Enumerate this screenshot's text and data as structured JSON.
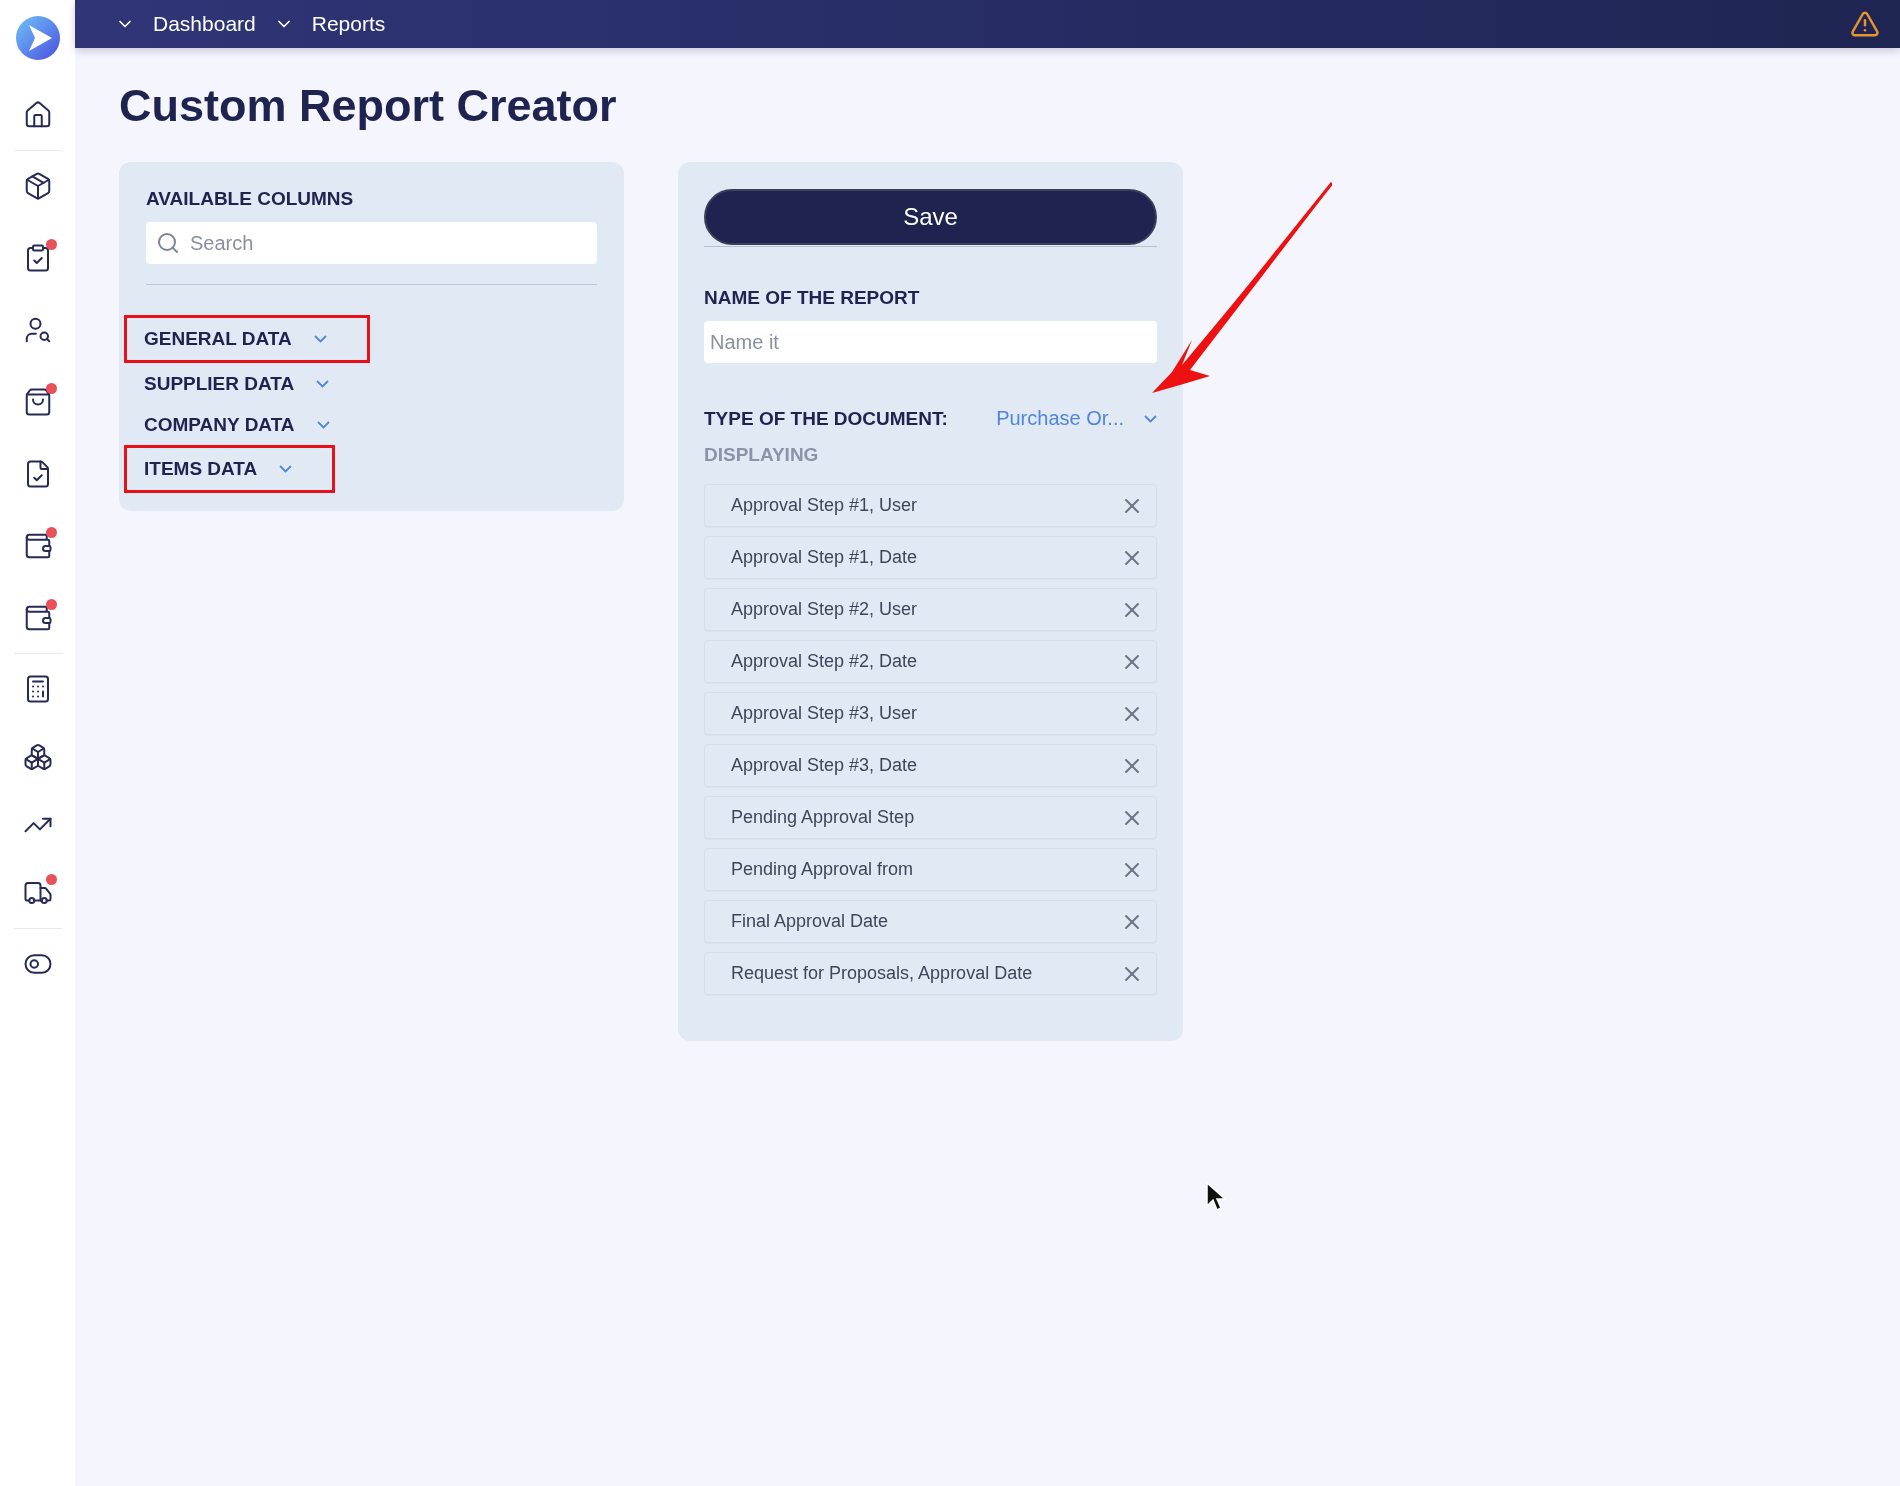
{
  "sidebar": {
    "groups": [
      [
        {
          "badge": false
        }
      ],
      [
        {
          "badge": false
        },
        {
          "badge": true
        },
        {
          "badge": false
        },
        {
          "badge": true
        },
        {
          "badge": false
        },
        {
          "badge": true
        },
        {
          "badge": true
        }
      ],
      [
        {
          "badge": false
        },
        {
          "badge": false
        },
        {
          "badge": false
        },
        {
          "badge": true
        }
      ],
      [
        {
          "badge": false
        }
      ]
    ]
  },
  "breadcrumbs": [
    "Dashboard",
    "Reports"
  ],
  "page_title": "Custom Report Creator",
  "available_columns": {
    "title": "AVAILABLE COLUMNS",
    "search": {
      "placeholder": "Search"
    },
    "categories": [
      {
        "label": "GENERAL DATA",
        "highlighted": true
      },
      {
        "label": "SUPPLIER DATA",
        "highlighted": false
      },
      {
        "label": "COMPANY DATA",
        "highlighted": false
      },
      {
        "label": "ITEMS DATA",
        "highlighted": true
      }
    ]
  },
  "report": {
    "save_button": "Save",
    "name_label": "NAME OF THE REPORT",
    "name_field": {
      "placeholder": "Name it"
    },
    "type_label": "TYPE OF THE DOCUMENT:",
    "type_value": "Purchase Or...",
    "displaying_label": "DISPLAYING",
    "columns": [
      "Approval Step #1, User",
      "Approval Step #1, Date",
      "Approval Step #2, User",
      "Approval Step #2, Date",
      "Approval Step #3, User",
      "Approval Step #3, Date",
      "Pending Approval Step",
      "Pending Approval from",
      "Final Approval Date",
      "Request for Proposals, Approval Date"
    ]
  }
}
